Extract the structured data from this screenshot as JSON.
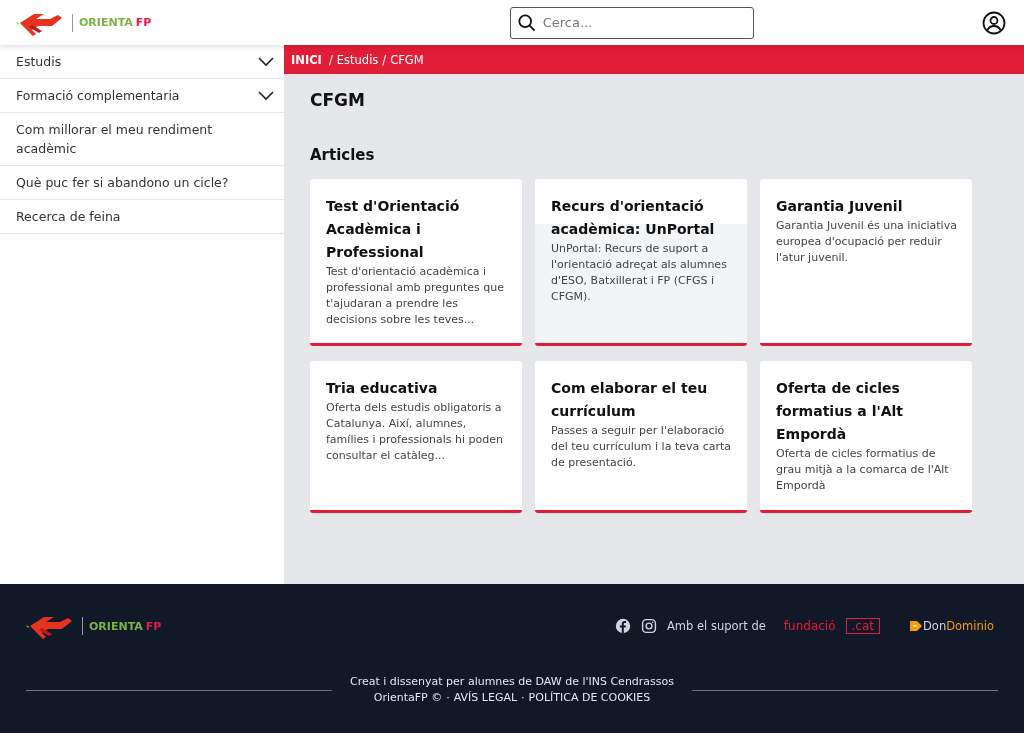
{
  "header": {
    "logo": {
      "word": "ORIENTA",
      "suffix": "FP"
    },
    "search": {
      "placeholder": "Cerca..."
    }
  },
  "sidebar": {
    "items": [
      {
        "label": "Estudis",
        "kind": "dropdown"
      },
      {
        "label": "Formació complementaria",
        "kind": "dropdown"
      },
      {
        "label": "Com millorar el meu rendiment acadèmic",
        "kind": "link"
      },
      {
        "label": "Què puc fer si abandono un cicle?",
        "kind": "link"
      },
      {
        "label": "Recerca de feina",
        "kind": "link"
      }
    ]
  },
  "breadcrumb": {
    "items": [
      "INICI",
      "Estudis",
      "CFGM"
    ],
    "separator": "/"
  },
  "page_title": "CFGM",
  "section_title": "Articles",
  "articles": [
    {
      "title": "Test d'Orientació Acadèmica i Professional",
      "text": "Test d'orientació acadèmica i professional amb preguntes que t'ajudaran a prendre les decisions sobre les teves...",
      "hovered": false
    },
    {
      "title": "Recurs d'orientació acadèmica: UnPortal",
      "text": "UnPortal: Recurs de suport a l'orientació adreçat als alumnes d'ESO, Batxillerat i FP (CFGS i CFGM).",
      "hovered": true
    },
    {
      "title": "Garantia Juvenil",
      "text": "Garantia Juvenil és una iniciativa europea d'ocupació per reduir l'atur juvenil.",
      "hovered": false
    },
    {
      "title": "Tria educativa",
      "text": "Oferta dels estudis obligatoris a Catalunya. Així, alumnes, famílies i professionals hi poden consultar el catàleg...",
      "hovered": false
    },
    {
      "title": "Com elaborar el teu currículum",
      "text": "Passes a seguir per l'elaboració del teu currículum i la teva carta de presentació.",
      "hovered": false
    },
    {
      "title": "Oferta de cicles formatius a l'Alt Empordà",
      "text": "Oferta de cicles formatius de grau mitjà a la comarca de l'Alt Empordà",
      "hovered": false
    }
  ],
  "footer": {
    "logo": {
      "word": "ORIENTA",
      "suffix": "FP"
    },
    "support_label": "Amb el suport de",
    "sponsor_1": {
      "name": "fundació",
      "badge": ".cat"
    },
    "sponsor_2": {
      "part_1": "Don",
      "part_2": "Dominio"
    },
    "credit": "Creat i dissenyat per alumnes de DAW de l'INS Cendrassos",
    "legal": [
      "OrientaFP ©",
      "AVÍS LEGAL",
      "POLÍTICA DE COOKIES"
    ],
    "separator": "·"
  }
}
